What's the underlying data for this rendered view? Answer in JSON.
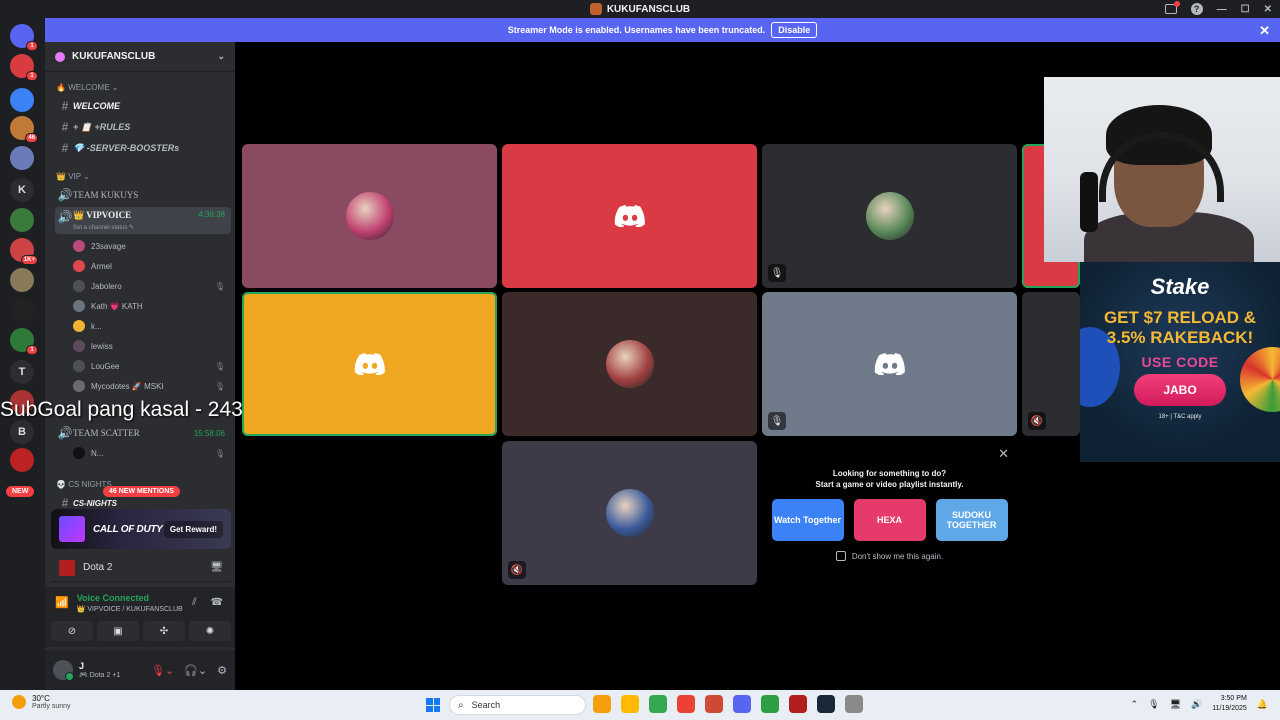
{
  "window": {
    "title": "KUKUFANSCLUB"
  },
  "banner": {
    "message": "Streamer Mode is enabled. Usernames have been truncated.",
    "disable_label": "Disable"
  },
  "guilds": [
    {
      "badge": "1",
      "color": "#5865f2",
      "icon": "discord-home-icon"
    },
    {
      "badge": "1",
      "color": "#d83c3e"
    },
    {
      "badge": "",
      "color": "#3b82f6"
    },
    {
      "badge": "46",
      "color": "#c07a3a"
    },
    {
      "badge": "",
      "color": "#6b7bb8"
    },
    {
      "badge": "",
      "color": "#2b2d31",
      "letter": "K"
    },
    {
      "badge": "",
      "color": "#3a7a3a"
    },
    {
      "badge": "1K+",
      "color": "#c44"
    },
    {
      "badge": "",
      "color": "#8a7a5a"
    },
    {
      "badge": "",
      "color": "#222"
    },
    {
      "badge": "1",
      "color": "#2f7a3a"
    },
    {
      "badge": "",
      "color": "#2b2d31",
      "letter": "T"
    },
    {
      "badge": "",
      "color": "#a33"
    },
    {
      "badge": "",
      "color": "#2b2d31",
      "letter": "B"
    },
    {
      "badge": "",
      "color": "#b22"
    }
  ],
  "new_label": "NEW",
  "sidebar": {
    "server_name": "KUKUFANSCLUB",
    "cat_welcome": "WELCOME",
    "chan_welcome": "WELCOME",
    "chan_rules": "+ 📋 +RULES",
    "chan_boosters": "💎 -SERVER-BOOSTERs",
    "cat_vip": "VIP",
    "chan_team_kukuys": "TEAM KUKUYS",
    "chan_vipvoice": "VIPVOICE",
    "vipvoice_time": "4:36:38",
    "vipvoice_status": "Set a channel status",
    "voice_users": [
      {
        "name": "23savage",
        "color": "#b94a7d"
      },
      {
        "name": "Armel",
        "color": "#e0474c"
      },
      {
        "name": "Jabolero",
        "color": "#4e5058"
      },
      {
        "name": "Kath 💗 KATH",
        "color": "#6b7280"
      },
      {
        "name": "k...",
        "color": "#f0b232"
      },
      {
        "name": "lewiss",
        "color": "#5d4a5e"
      },
      {
        "name": "LouGee",
        "color": "#4e5058"
      },
      {
        "name": "Mycodotes 🚀 MSKI",
        "color": "#6b6b6b"
      }
    ],
    "chan_team_scatter": "TEAM SCATTER",
    "team_scatter_time": "15:58:06",
    "scatter_user": "N...",
    "cat_cs": "CS NIGHTS",
    "chan_cs": "CS-NIGHTS",
    "mentions_label": "46 NEW MENTIONS"
  },
  "promo": {
    "title": "CALL OF DUTY",
    "button": "Get Reward!"
  },
  "activity": {
    "game": "Dota 2"
  },
  "voice": {
    "status": "Voice Connected",
    "channel": "👑 VIPVOICE / KUKUFANSCLUB"
  },
  "user": {
    "name": "J",
    "status": "🎮 Dota 2 +1"
  },
  "overlay": {
    "subgoal": "SubGoal pang kasal - 243/3000"
  },
  "tiles": [
    {
      "bg": "#8a4a62",
      "type": "avatar",
      "av": "#c04070",
      "corner": "",
      "speaking": false
    },
    {
      "bg": "#d93a44",
      "type": "discord",
      "corner": "",
      "speaking": false
    },
    {
      "bg": "#2b2d31",
      "type": "avatar",
      "av": "#5a8a5a",
      "corner": "🎙",
      "speaking": false
    },
    {
      "bg": "#f0a823",
      "type": "discord",
      "corner": "",
      "speaking": true
    },
    {
      "bg": "#3a2a2a",
      "type": "avatar",
      "av": "#a04040",
      "corner": "",
      "speaking": false
    },
    {
      "bg": "#6f7a8a",
      "type": "discord",
      "corner": "🎙",
      "speaking": false
    },
    {
      "bg": "#3e3a48",
      "type": "avatar",
      "av": "#3a5a9a",
      "corner": "🔇",
      "speaking": false
    }
  ],
  "suggest": {
    "line1": "Looking for something to do?",
    "line2": "Start a game or video playlist instantly.",
    "games": [
      {
        "label": "Watch Together",
        "color": "#3b82f6"
      },
      {
        "label": "HEXA",
        "color": "#e63a6a"
      },
      {
        "label": "SUDOKU TOGETHER",
        "color": "#5fa8e8"
      }
    ],
    "checkbox": "Don't show me this again."
  },
  "stake": {
    "logo": "Stake",
    "headline1": "GET $7 RELOAD &",
    "headline2": "3.5% RAKEBACK!",
    "use_code": "USE CODE",
    "code": "JABO",
    "fine": "18+ | T&C apply"
  },
  "taskbar": {
    "temp": "30°C",
    "condition": "Partly sunny",
    "search": "Search",
    "time": "3:50 PM",
    "date": "11/19/2025",
    "apps": [
      "#f59e0b",
      "#ffb900",
      "#34a853",
      "#ea4335",
      "#d14836",
      "#5865f2",
      "#2ea043",
      "#b21d1d",
      "#1b2838",
      "#8a8a8a"
    ]
  }
}
